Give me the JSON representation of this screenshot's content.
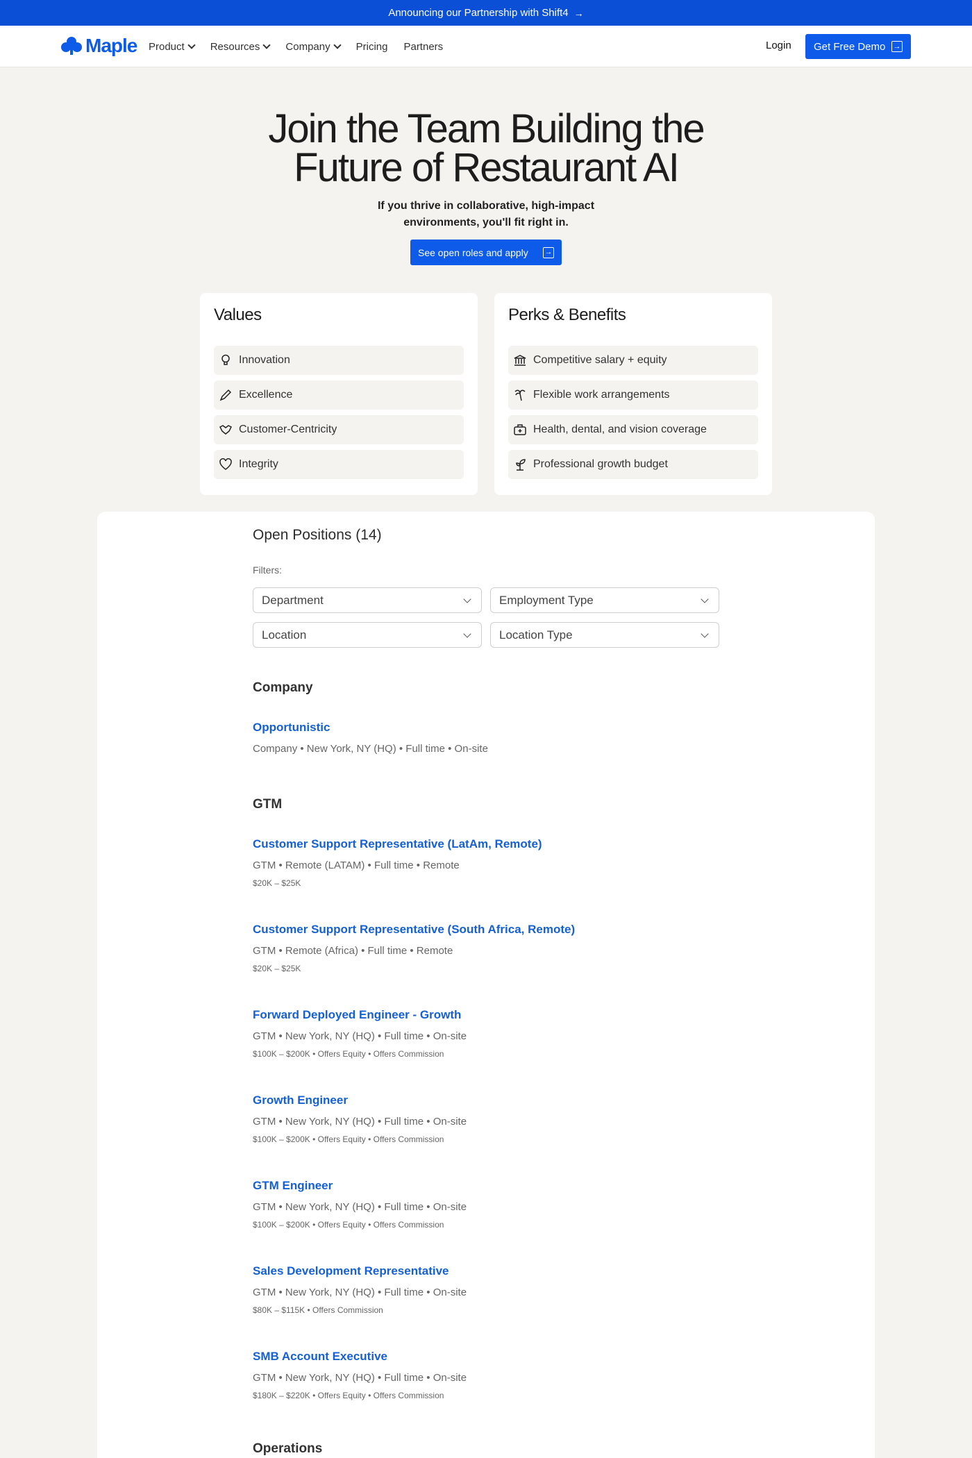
{
  "announcement": {
    "text": "Announcing our Partnership with Shift4",
    "arrow": "→"
  },
  "nav": {
    "logo_text": "Maple",
    "links": [
      "Product",
      "Resources",
      "Company",
      "Pricing",
      "Partners"
    ],
    "login": "Login",
    "demo_button": "Get Free Demo",
    "brand_color": "#0d5be8"
  },
  "hero": {
    "title_line1": "Join the Team Building the",
    "title_line2": "Future of Restaurant AI",
    "subtitle_line1": "If you thrive in collaborative, high-impact",
    "subtitle_line2": "environments, you'll fit right in.",
    "cta": "See open roles and apply"
  },
  "values": {
    "title": "Values",
    "items": [
      {
        "label": "Innovation",
        "icon": "lightbulb-icon"
      },
      {
        "label": "Excellence",
        "icon": "pen-icon"
      },
      {
        "label": "Customer-Centricity",
        "icon": "handshake-icon"
      },
      {
        "label": "Integrity",
        "icon": "heart-icon"
      }
    ]
  },
  "perks": {
    "title": "Perks & Benefits",
    "items": [
      {
        "label": "Competitive salary + equity",
        "icon": "bank-icon"
      },
      {
        "label": "Flexible work arrangements",
        "icon": "palm-tree-icon"
      },
      {
        "label": "Health, dental, and vision coverage",
        "icon": "medical-kit-icon"
      },
      {
        "label": "Professional growth budget",
        "icon": "sprout-icon"
      }
    ]
  },
  "positions": {
    "title": "Open Positions (14)",
    "filters_label": "Filters:",
    "filters": [
      "Department",
      "Employment Type",
      "Location",
      "Location Type"
    ],
    "departments": [
      {
        "name": "Company",
        "jobs": [
          {
            "title": "Opportunistic",
            "meta": "Company • New York, NY (HQ) • Full time • On-site",
            "comp": ""
          }
        ]
      },
      {
        "name": "GTM",
        "jobs": [
          {
            "title": "Customer Support Representative (LatAm, Remote)",
            "meta": "GTM • Remote (LATAM) • Full time • Remote",
            "comp": "$20K – $25K"
          },
          {
            "title": "Customer Support Representative (South Africa, Remote)",
            "meta": "GTM • Remote (Africa) • Full time • Remote",
            "comp": "$20K – $25K"
          },
          {
            "title": "Forward Deployed Engineer - Growth",
            "meta": "GTM • New York, NY (HQ) • Full time • On-site",
            "comp": "$100K – $200K • Offers Equity • Offers Commission"
          },
          {
            "title": "Growth Engineer",
            "meta": "GTM • New York, NY (HQ) • Full time • On-site",
            "comp": "$100K – $200K • Offers Equity • Offers Commission"
          },
          {
            "title": "GTM Engineer",
            "meta": "GTM • New York, NY (HQ) • Full time • On-site",
            "comp": "$100K – $200K • Offers Equity • Offers Commission"
          },
          {
            "title": "Sales Development Representative",
            "meta": "GTM • New York, NY (HQ) • Full time • On-site",
            "comp": "$80K – $115K • Offers Commission"
          },
          {
            "title": "SMB Account Executive",
            "meta": "GTM • New York, NY (HQ) • Full time • On-site",
            "comp": "$180K – $220K • Offers Equity • Offers Commission"
          }
        ]
      },
      {
        "name": "Operations",
        "jobs": []
      }
    ]
  }
}
